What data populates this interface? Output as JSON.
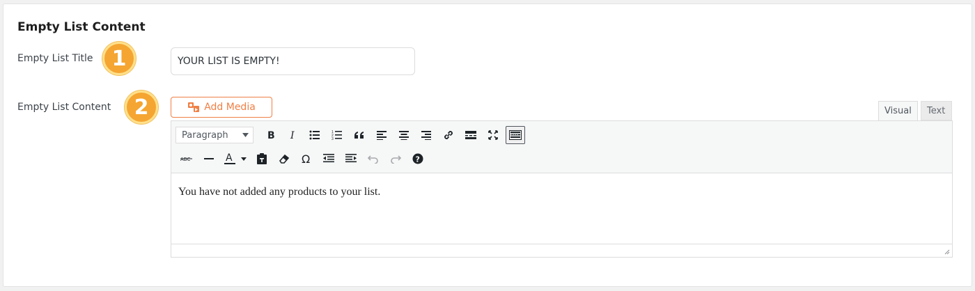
{
  "section": {
    "title": "Empty List Content"
  },
  "fields": {
    "title_label": "Empty List Title",
    "title_value": "YOUR LIST IS EMPTY!",
    "content_label": "Empty List Content"
  },
  "badges": [
    "1",
    "2"
  ],
  "editor": {
    "add_media_label": "Add Media",
    "tabs": {
      "visual": "Visual",
      "text": "Text"
    },
    "format_select": "Paragraph",
    "content": "You have not added any products to your list."
  },
  "colors": {
    "accent": "#f07f44",
    "badge": "#f5a531"
  }
}
